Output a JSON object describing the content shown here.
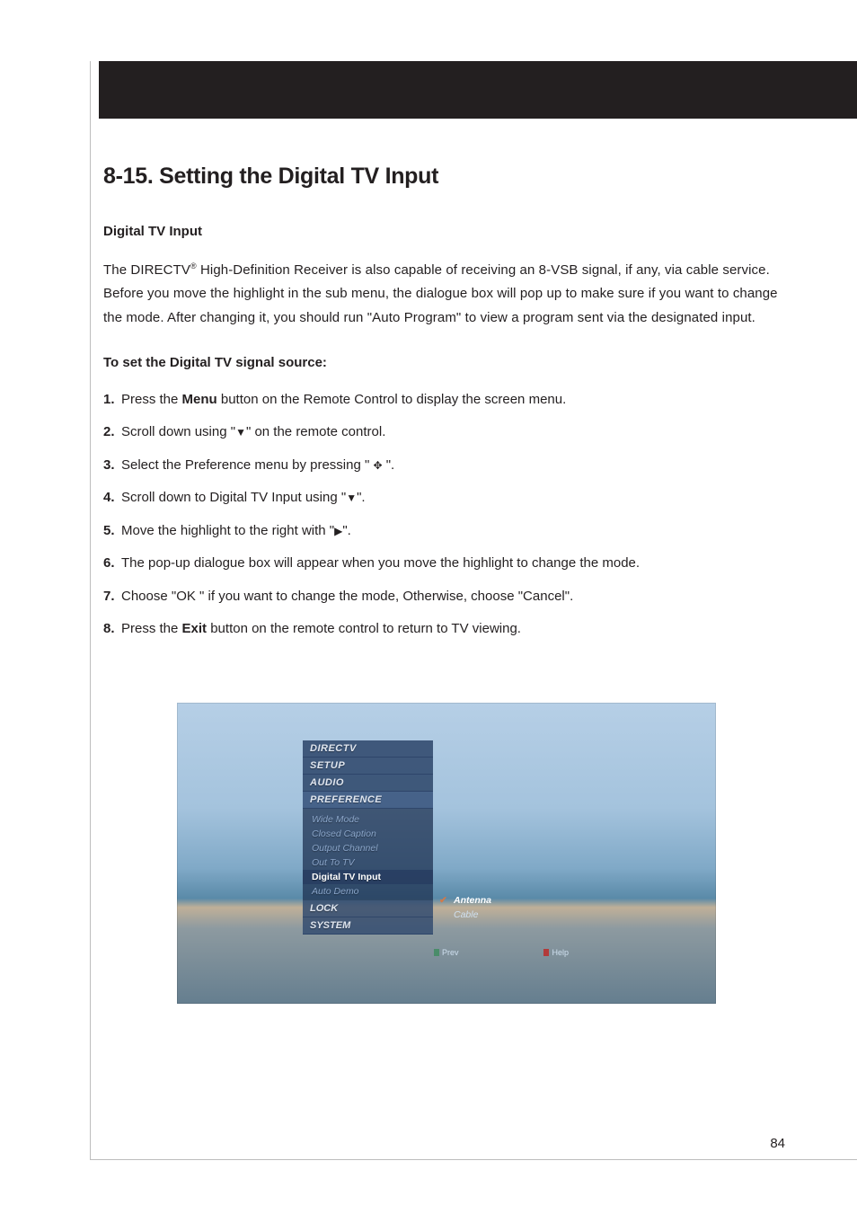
{
  "heading": "8-15. Setting the Digital TV Input",
  "subhead1": "Digital TV Input",
  "intro": {
    "pre": "The DIRECTV",
    "sup": "®",
    "rest": " High-Definition Receiver is also capable of receiving an 8-VSB signal, if any, via cable service.  Before you move the highlight in the sub menu, the dialogue box will pop up to make sure if you want to change the mode.  After changing it, you should run \"Auto Program\" to view a program sent via the designated input."
  },
  "subhead2": "To set the Digital TV signal source:",
  "steps": [
    {
      "pre": "Press the ",
      "bold": "Menu",
      "post": " button on the Remote Control to display the screen menu."
    },
    {
      "pre": "Scroll down using \"",
      "glyph": "▼",
      "post": "\" on the remote control."
    },
    {
      "pre": "Select the Preference menu by pressing \" ",
      "glyph": "✥",
      "post": " \"."
    },
    {
      "pre": "Scroll down to Digital TV Input using \"",
      "glyph": "▼",
      "post": "\"."
    },
    {
      "pre": "Move the highlight to the right with \"",
      "glyph": "▶",
      "post": "\"."
    },
    {
      "text": "The pop-up dialogue box will appear when you move the highlight to change the mode."
    },
    {
      "text": "Choose \"OK \" if you want to change the mode, Otherwise, choose \"Cancel\"."
    },
    {
      "pre": "Press the ",
      "bold": "Exit",
      "post": " button on the remote control to return to TV viewing."
    }
  ],
  "screenshot": {
    "menu": [
      "DIRECTV",
      "SETUP",
      "AUDIO",
      "PREFERENCE"
    ],
    "submenu": [
      {
        "label": "Wide Mode",
        "selected": false
      },
      {
        "label": "Closed Caption",
        "selected": false
      },
      {
        "label": "Output Channel",
        "selected": false
      },
      {
        "label": "Out To TV",
        "selected": false
      },
      {
        "label": "Digital TV Input",
        "selected": true
      },
      {
        "label": "Auto Demo",
        "selected": false
      }
    ],
    "lower_menu": [
      "LOCK",
      "SYSTEM"
    ],
    "options": [
      {
        "label": "Antenna",
        "selected": true
      },
      {
        "label": "Cable",
        "selected": false
      }
    ],
    "footer": {
      "prev": "Prev",
      "help": "Help"
    }
  },
  "page_number": "84"
}
